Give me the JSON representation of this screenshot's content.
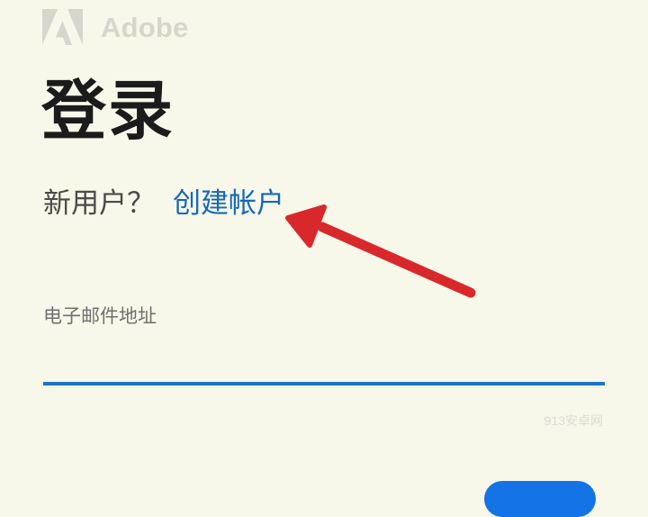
{
  "brand": {
    "name": "Adobe",
    "logo_icon": "adobe-logo-icon",
    "logo_color": "#d6d6cd"
  },
  "page": {
    "title": "登录",
    "background": "#f7f7ea"
  },
  "signup": {
    "prompt": "新用户？",
    "link_label": "创建帐户",
    "link_color": "#1468b8"
  },
  "annotation": {
    "icon": "red-arrow-icon",
    "color": "#d9282b"
  },
  "email": {
    "label": "电子邮件地址",
    "value": "",
    "underline_color": "#1a74c8"
  },
  "watermark": {
    "text": "913安卓网"
  },
  "continue_button": {
    "color": "#1473e6"
  }
}
